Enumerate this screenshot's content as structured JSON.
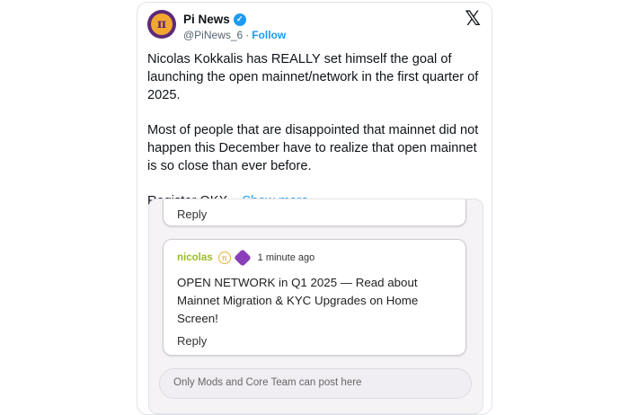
{
  "account": {
    "name": "Pi News",
    "handle": "@PiNews_6",
    "separator": "·",
    "follow": "Follow",
    "avatar_glyph": "π",
    "verified_glyph": "✓",
    "x_logo": "𝕏"
  },
  "tweet": {
    "paragraph1": "Nicolas Kokkalis has REALLY set himself the goal of launching the open mainnet/network in the first quarter of 2025.",
    "paragraph2": "Most of people that are disappointed that mainnet did not happen this December have to realize that open mainnet is so close than ever before.",
    "paragraph3": "Register OKX...",
    "show_more": "Show more"
  },
  "embed": {
    "top_reply": "Reply",
    "comment": {
      "user": "nicolas",
      "badge_glyph": "π",
      "time": "1 minute ago",
      "text": "OPEN NETWORK in Q1 2025 — Read about Mainnet Migration & KYC Upgrades on Home Screen!",
      "reply": "Reply"
    },
    "input_placeholder": "Only Mods and Core Team can post here"
  },
  "colors": {
    "link": "#1d9bf0",
    "pi_purple": "#5d2a78",
    "pi_gold": "#f2a830",
    "username_green": "#9bbb2a"
  }
}
